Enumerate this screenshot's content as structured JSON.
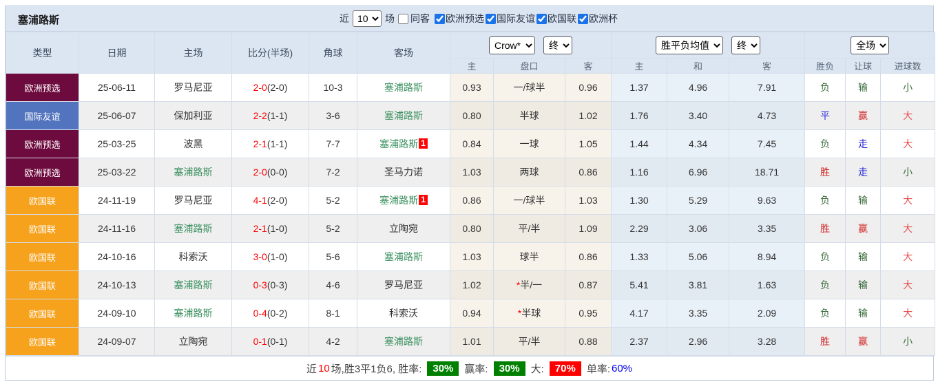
{
  "topbar": {
    "title": "塞浦路斯",
    "near_label": "近",
    "recent_count": "10",
    "games_label": "场",
    "same_venue_label": "同客",
    "filters": [
      {
        "label": "欧洲预选",
        "checked": true
      },
      {
        "label": "国际友谊",
        "checked": true
      },
      {
        "label": "欧国联",
        "checked": true
      },
      {
        "label": "欧洲杯",
        "checked": true
      }
    ]
  },
  "header": {
    "cols": [
      "类型",
      "日期",
      "主场",
      "比分(半场)",
      "角球",
      "客场"
    ],
    "odds_select": "Crow*",
    "odds_period_select": "终",
    "odds_sub": [
      "主",
      "盘口",
      "客"
    ],
    "avg_select": "胜平负均值",
    "avg_period_select": "终",
    "avg_sub": [
      "主",
      "和",
      "客"
    ],
    "result_select": "全场",
    "result_sub": [
      "胜负",
      "让球",
      "进球数"
    ]
  },
  "colors": {
    "type_euro_qualifier": "#6E0B3E",
    "type_friendly": "#5274BE",
    "type_nations_league": "#F6A21D",
    "cyprus_green": "#3C9161",
    "score_red": "#FF0000",
    "win_rate_badge": "#008000",
    "big_rate_badge": "#FF0000",
    "single_rate_text": "#0000EE"
  },
  "rows": [
    {
      "type": "欧洲预选",
      "tc": "type_euro_qualifier",
      "date": "25-06-11",
      "home": "罗马尼亚",
      "hg": false,
      "score": "2-0",
      "half": "(2-0)",
      "corner": "10-3",
      "away": "塞浦路斯",
      "ag": true,
      "badge": "",
      "o1": "0.93",
      "star": false,
      "pk": "一/球半",
      "o2": "0.96",
      "a1": "1.37",
      "a2": "4.96",
      "a3": "7.91",
      "r": "负",
      "rc": "loss",
      "h": "输",
      "hc": "loss",
      "g": "小",
      "gc": "small"
    },
    {
      "type": "国际友谊",
      "tc": "type_friendly",
      "date": "25-06-07",
      "home": "保加利亚",
      "hg": false,
      "score": "2-2",
      "half": "(1-1)",
      "corner": "3-6",
      "away": "塞浦路斯",
      "ag": true,
      "badge": "",
      "o1": "0.80",
      "star": false,
      "pk": "半球",
      "o2": "1.02",
      "a1": "1.76",
      "a2": "3.40",
      "a3": "4.73",
      "r": "平",
      "rc": "draw",
      "h": "赢",
      "hc": "win",
      "g": "大",
      "gc": "big"
    },
    {
      "type": "欧洲预选",
      "tc": "type_euro_qualifier",
      "date": "25-03-25",
      "home": "波黑",
      "hg": false,
      "score": "2-1",
      "half": "(1-1)",
      "corner": "7-7",
      "away": "塞浦路斯",
      "ag": true,
      "badge": "1",
      "o1": "0.84",
      "star": false,
      "pk": "一球",
      "o2": "1.05",
      "a1": "1.44",
      "a2": "4.34",
      "a3": "7.45",
      "r": "负",
      "rc": "loss",
      "h": "走",
      "hc": "draw",
      "g": "大",
      "gc": "big"
    },
    {
      "type": "欧洲预选",
      "tc": "type_euro_qualifier",
      "date": "25-03-22",
      "home": "塞浦路斯",
      "hg": true,
      "score": "2-0",
      "half": "(0-0)",
      "corner": "7-2",
      "away": "圣马力诺",
      "ag": false,
      "badge": "",
      "o1": "1.03",
      "star": false,
      "pk": "两球",
      "o2": "0.86",
      "a1": "1.16",
      "a2": "6.96",
      "a3": "18.71",
      "r": "胜",
      "rc": "win",
      "h": "走",
      "hc": "draw",
      "g": "小",
      "gc": "small"
    },
    {
      "type": "欧国联",
      "tc": "type_nations_league",
      "date": "24-11-19",
      "home": "罗马尼亚",
      "hg": false,
      "score": "4-1",
      "half": "(2-0)",
      "corner": "5-2",
      "away": "塞浦路斯",
      "ag": true,
      "badge": "1",
      "o1": "0.86",
      "star": false,
      "pk": "一/球半",
      "o2": "1.03",
      "a1": "1.30",
      "a2": "5.29",
      "a3": "9.63",
      "r": "负",
      "rc": "loss",
      "h": "输",
      "hc": "loss",
      "g": "大",
      "gc": "big"
    },
    {
      "type": "欧国联",
      "tc": "type_nations_league",
      "date": "24-11-16",
      "home": "塞浦路斯",
      "hg": true,
      "score": "2-1",
      "half": "(1-0)",
      "corner": "5-2",
      "away": "立陶宛",
      "ag": false,
      "badge": "",
      "o1": "0.80",
      "star": false,
      "pk": "平/半",
      "o2": "1.09",
      "a1": "2.29",
      "a2": "3.06",
      "a3": "3.35",
      "r": "胜",
      "rc": "win",
      "h": "赢",
      "hc": "win",
      "g": "大",
      "gc": "big"
    },
    {
      "type": "欧国联",
      "tc": "type_nations_league",
      "date": "24-10-16",
      "home": "科索沃",
      "hg": false,
      "score": "3-0",
      "half": "(1-0)",
      "corner": "5-6",
      "away": "塞浦路斯",
      "ag": true,
      "badge": "",
      "o1": "1.03",
      "star": false,
      "pk": "球半",
      "o2": "0.86",
      "a1": "1.33",
      "a2": "5.06",
      "a3": "8.94",
      "r": "负",
      "rc": "loss",
      "h": "输",
      "hc": "loss",
      "g": "大",
      "gc": "big"
    },
    {
      "type": "欧国联",
      "tc": "type_nations_league",
      "date": "24-10-13",
      "home": "塞浦路斯",
      "hg": true,
      "score": "0-3",
      "half": "(0-3)",
      "corner": "4-6",
      "away": "罗马尼亚",
      "ag": false,
      "badge": "",
      "o1": "1.02",
      "star": true,
      "pk": "半/一",
      "o2": "0.87",
      "a1": "5.41",
      "a2": "3.81",
      "a3": "1.63",
      "r": "负",
      "rc": "loss",
      "h": "输",
      "hc": "loss",
      "g": "大",
      "gc": "big"
    },
    {
      "type": "欧国联",
      "tc": "type_nations_league",
      "date": "24-09-10",
      "home": "塞浦路斯",
      "hg": true,
      "score": "0-4",
      "half": "(0-2)",
      "corner": "8-1",
      "away": "科索沃",
      "ag": false,
      "badge": "",
      "o1": "0.94",
      "star": true,
      "pk": "半球",
      "o2": "0.95",
      "a1": "4.17",
      "a2": "3.35",
      "a3": "2.09",
      "r": "负",
      "rc": "loss",
      "h": "输",
      "hc": "loss",
      "g": "大",
      "gc": "big"
    },
    {
      "type": "欧国联",
      "tc": "type_nations_league",
      "date": "24-09-07",
      "home": "立陶宛",
      "hg": false,
      "score": "0-1",
      "half": "(0-1)",
      "corner": "4-2",
      "away": "塞浦路斯",
      "ag": true,
      "badge": "",
      "o1": "1.01",
      "star": false,
      "pk": "平/半",
      "o2": "0.88",
      "a1": "2.37",
      "a2": "2.96",
      "a3": "3.28",
      "r": "胜",
      "rc": "win",
      "h": "赢",
      "hc": "win",
      "g": "小",
      "gc": "small"
    }
  ],
  "footer": {
    "near_label": "近",
    "count": "10",
    "summary": "场,胜3平1负6, 胜率:",
    "win_rate": "30%",
    "handicap_label": "赢率:",
    "handicap_rate": "30%",
    "big_label": "大:",
    "big_rate": "70%",
    "single_label": "单率:",
    "single_rate": "60%"
  }
}
